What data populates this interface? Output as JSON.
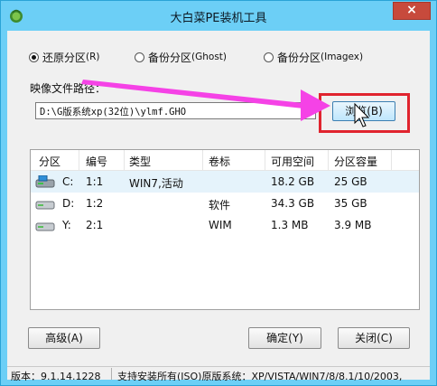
{
  "window": {
    "title": "大白菜PE装机工具",
    "close_label": "×"
  },
  "modes": [
    {
      "label": "还原分区",
      "key": "(R)",
      "checked": true
    },
    {
      "label": "备份分区",
      "key": "(Ghost)",
      "checked": false
    },
    {
      "label": "备份分区",
      "key": "(Imagex)",
      "checked": false
    }
  ],
  "image_path": {
    "label": "映像文件路径：",
    "value": "D:\\G版系统xp(32位)\\ylmf.GHO"
  },
  "browse_button": {
    "label": "浏览(B)"
  },
  "partition_table": {
    "columns": [
      "分区",
      "编号",
      "类型",
      "卷标",
      "可用空间",
      "分区容量"
    ],
    "rows": [
      {
        "drive": "C:",
        "number": "1:1",
        "type": "WIN7,活动",
        "label": "",
        "free": "18.2 GB",
        "capacity": "25 GB",
        "selected": true
      },
      {
        "drive": "D:",
        "number": "1:2",
        "type": "",
        "label": "软件",
        "free": "34.3 GB",
        "capacity": "35 GB",
        "selected": false
      },
      {
        "drive": "Y:",
        "number": "2:1",
        "type": "",
        "label": "WIM",
        "free": "1.3 MB",
        "capacity": "3.9 MB",
        "selected": false
      }
    ]
  },
  "buttons": {
    "advanced": "高级(A)",
    "ok": "确定(Y)",
    "close": "关闭(C)"
  },
  "status_bar": {
    "version": "版本：9.1.14.1228",
    "support": "支持安装所有(ISO)原版系统：XP/VISTA/WIN7/8/8.1/10/2003,"
  },
  "colors": {
    "title_bar": "#6ccff6",
    "highlight_box": "#e0242e",
    "arrow": "#f542e6"
  }
}
